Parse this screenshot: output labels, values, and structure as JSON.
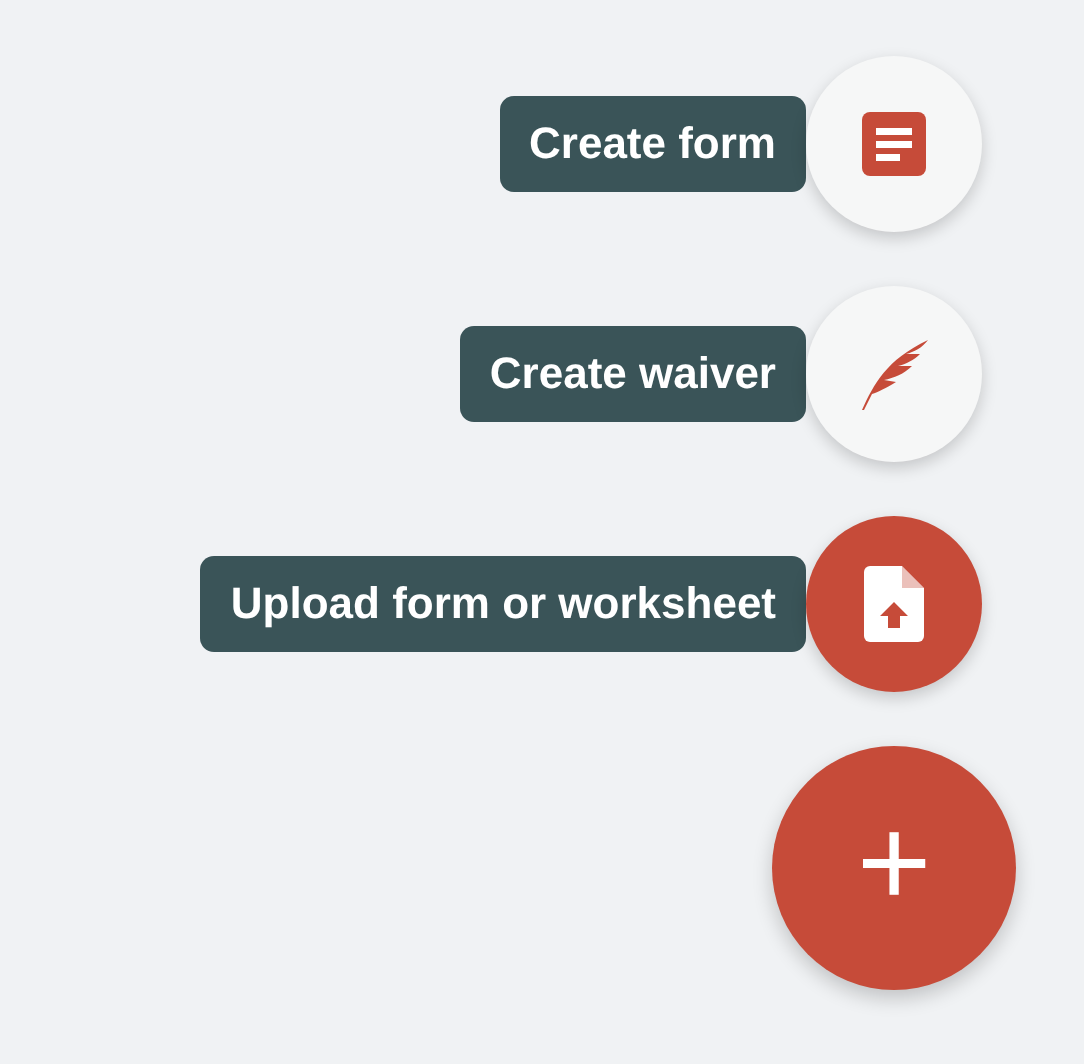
{
  "actions": [
    {
      "label": "Create form",
      "kind": "form",
      "highlighted": false
    },
    {
      "label": "Create waiver",
      "kind": "waiver",
      "highlighted": false
    },
    {
      "label": "Upload form or worksheet",
      "kind": "upload",
      "highlighted": true
    }
  ],
  "main_button": {
    "symbol": "+"
  }
}
